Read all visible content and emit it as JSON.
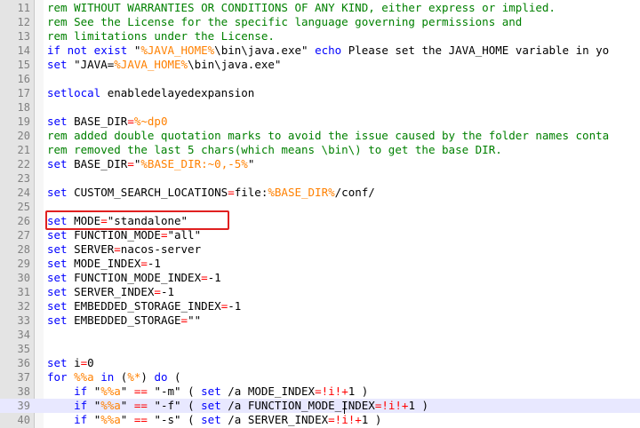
{
  "editor": {
    "lines": [
      {
        "n": "11",
        "tokens": [
          [
            "cm",
            "rem WITHOUT WARRANTIES OR CONDITIONS OF ANY KIND, either express or implied."
          ]
        ]
      },
      {
        "n": "12",
        "tokens": [
          [
            "cm",
            "rem See the License for the specific language governing permissions and"
          ]
        ]
      },
      {
        "n": "13",
        "tokens": [
          [
            "cm",
            "rem limitations under the License."
          ]
        ]
      },
      {
        "n": "14",
        "tokens": [
          [
            "kw",
            "if not exist "
          ],
          [
            "pl",
            "\""
          ],
          [
            "vr",
            "%JAVA_HOME%"
          ],
          [
            "pl",
            "\\bin\\java.exe\" "
          ],
          [
            "kw",
            "echo"
          ],
          [
            "pl",
            " Please set the JAVA_HOME variable in yo"
          ]
        ]
      },
      {
        "n": "15",
        "tokens": [
          [
            "kw",
            "set "
          ],
          [
            "pl",
            "\"JAVA="
          ],
          [
            "vr",
            "%JAVA_HOME%"
          ],
          [
            "pl",
            "\\bin\\java.exe\""
          ]
        ]
      },
      {
        "n": "16",
        "tokens": []
      },
      {
        "n": "17",
        "tokens": [
          [
            "kw",
            "setlocal "
          ],
          [
            "pl",
            "enabledelayedexpansion"
          ]
        ]
      },
      {
        "n": "18",
        "tokens": []
      },
      {
        "n": "19",
        "tokens": [
          [
            "kw",
            "set "
          ],
          [
            "pl",
            "BASE_DIR"
          ],
          [
            "op",
            "="
          ],
          [
            "vr",
            "%~dp0"
          ]
        ]
      },
      {
        "n": "20",
        "tokens": [
          [
            "cm",
            "rem added double quotation marks to avoid the issue caused by the folder names conta"
          ]
        ]
      },
      {
        "n": "21",
        "tokens": [
          [
            "cm",
            "rem removed the last 5 chars(which means \\bin\\) to get the base DIR."
          ]
        ]
      },
      {
        "n": "22",
        "tokens": [
          [
            "kw",
            "set "
          ],
          [
            "pl",
            "BASE_DIR"
          ],
          [
            "op",
            "="
          ],
          [
            "pl",
            "\""
          ],
          [
            "vr",
            "%BASE_DIR:~0,-5%"
          ],
          [
            "pl",
            "\""
          ]
        ]
      },
      {
        "n": "23",
        "tokens": []
      },
      {
        "n": "24",
        "tokens": [
          [
            "kw",
            "set "
          ],
          [
            "pl",
            "CUSTOM_SEARCH_LOCATIONS"
          ],
          [
            "op",
            "="
          ],
          [
            "pl",
            "file:"
          ],
          [
            "vr",
            "%BASE_DIR%"
          ],
          [
            "pl",
            "/conf/"
          ]
        ]
      },
      {
        "n": "25",
        "tokens": []
      },
      {
        "n": "26",
        "tokens": [
          [
            "kw",
            "set "
          ],
          [
            "pl",
            "MODE"
          ],
          [
            "op",
            "="
          ],
          [
            "pl",
            "\"standalone\""
          ]
        ]
      },
      {
        "n": "27",
        "tokens": [
          [
            "kw",
            "set "
          ],
          [
            "pl",
            "FUNCTION_MODE"
          ],
          [
            "op",
            "="
          ],
          [
            "pl",
            "\"all\""
          ]
        ]
      },
      {
        "n": "28",
        "tokens": [
          [
            "kw",
            "set "
          ],
          [
            "pl",
            "SERVER"
          ],
          [
            "op",
            "="
          ],
          [
            "pl",
            "nacos-server"
          ]
        ]
      },
      {
        "n": "29",
        "tokens": [
          [
            "kw",
            "set "
          ],
          [
            "pl",
            "MODE_INDEX"
          ],
          [
            "op",
            "="
          ],
          [
            "pl",
            "-1"
          ]
        ]
      },
      {
        "n": "30",
        "tokens": [
          [
            "kw",
            "set "
          ],
          [
            "pl",
            "FUNCTION_MODE_INDEX"
          ],
          [
            "op",
            "="
          ],
          [
            "pl",
            "-1"
          ]
        ]
      },
      {
        "n": "31",
        "tokens": [
          [
            "kw",
            "set "
          ],
          [
            "pl",
            "SERVER_INDEX"
          ],
          [
            "op",
            "="
          ],
          [
            "pl",
            "-1"
          ]
        ]
      },
      {
        "n": "32",
        "tokens": [
          [
            "kw",
            "set "
          ],
          [
            "pl",
            "EMBEDDED_STORAGE_INDEX"
          ],
          [
            "op",
            "="
          ],
          [
            "pl",
            "-1"
          ]
        ]
      },
      {
        "n": "33",
        "tokens": [
          [
            "kw",
            "set "
          ],
          [
            "pl",
            "EMBEDDED_STORAGE"
          ],
          [
            "op",
            "="
          ],
          [
            "pl",
            "\"\""
          ]
        ]
      },
      {
        "n": "34",
        "tokens": []
      },
      {
        "n": "35",
        "tokens": []
      },
      {
        "n": "36",
        "tokens": [
          [
            "kw",
            "set "
          ],
          [
            "pl",
            "i"
          ],
          [
            "op",
            "="
          ],
          [
            "pl",
            "0"
          ]
        ]
      },
      {
        "n": "37",
        "tokens": [
          [
            "kw",
            "for "
          ],
          [
            "vr",
            "%%a"
          ],
          [
            "kw",
            " in "
          ],
          [
            "pl",
            "("
          ],
          [
            "vr",
            "%*"
          ],
          [
            "pl",
            ") "
          ],
          [
            "kw",
            "do "
          ],
          [
            "pl",
            "("
          ]
        ]
      },
      {
        "n": "38",
        "tokens": [
          [
            "pl",
            "    "
          ],
          [
            "kw",
            "if "
          ],
          [
            "pl",
            "\""
          ],
          [
            "vr",
            "%%a"
          ],
          [
            "pl",
            "\" "
          ],
          [
            "op",
            "=="
          ],
          [
            "pl",
            " \"-m\" ( "
          ],
          [
            "kw",
            "set"
          ],
          [
            "pl",
            " /a MODE_INDEX"
          ],
          [
            "op",
            "="
          ],
          [
            "op",
            "!i!"
          ],
          [
            "op",
            "+"
          ],
          [
            "pl",
            "1 )"
          ]
        ]
      },
      {
        "n": "39",
        "tokens": [
          [
            "pl",
            "    "
          ],
          [
            "kw",
            "if "
          ],
          [
            "pl",
            "\""
          ],
          [
            "vr",
            "%%a"
          ],
          [
            "pl",
            "\" "
          ],
          [
            "op",
            "=="
          ],
          [
            "pl",
            " \"-f\" ( "
          ],
          [
            "kw",
            "set"
          ],
          [
            "pl",
            " /a FUNCTION_MODE_INDEX"
          ],
          [
            "op",
            "="
          ],
          [
            "op",
            "!i!"
          ],
          [
            "op",
            "+"
          ],
          [
            "pl",
            "1 )"
          ]
        ],
        "current": true
      },
      {
        "n": "40",
        "tokens": [
          [
            "pl",
            "    "
          ],
          [
            "kw",
            "if "
          ],
          [
            "pl",
            "\""
          ],
          [
            "vr",
            "%%a"
          ],
          [
            "pl",
            "\" "
          ],
          [
            "op",
            "=="
          ],
          [
            "pl",
            " \"-s\" ( "
          ],
          [
            "kw",
            "set"
          ],
          [
            "pl",
            " /a SERVER_INDEX"
          ],
          [
            "op",
            "="
          ],
          [
            "op",
            "!i!"
          ],
          [
            "op",
            "+"
          ],
          [
            "pl",
            "1 )"
          ]
        ]
      }
    ]
  }
}
